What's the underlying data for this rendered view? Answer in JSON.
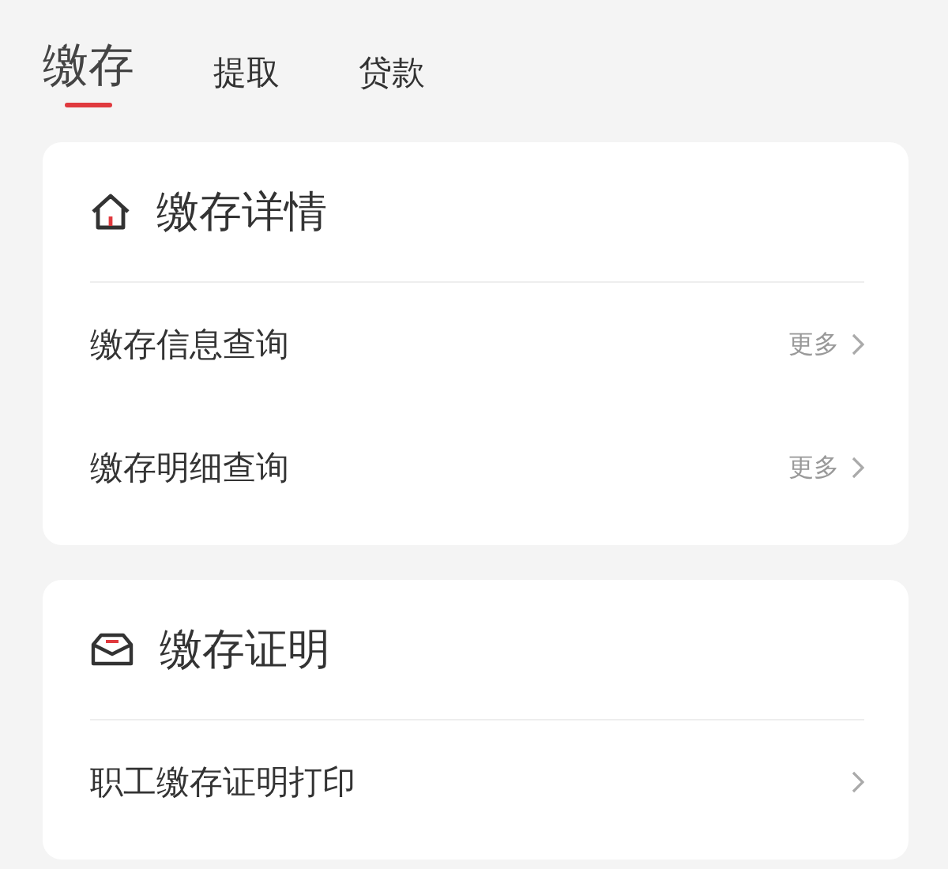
{
  "tabs": [
    {
      "label": "缴存",
      "selected": true
    },
    {
      "label": "提取",
      "selected": false
    },
    {
      "label": "贷款",
      "selected": false
    }
  ],
  "sections": [
    {
      "title": "缴存详情",
      "rows": [
        {
          "label": "缴存信息查询",
          "more": "更多"
        },
        {
          "label": "缴存明细查询",
          "more": "更多"
        }
      ]
    },
    {
      "title": "缴存证明",
      "rows": [
        {
          "label": "职工缴存证明打印"
        }
      ]
    }
  ]
}
